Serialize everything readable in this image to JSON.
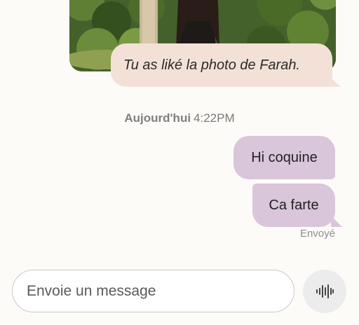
{
  "conversation": {
    "like_notice": "Tu as liké la photo de Farah.",
    "date_separator": {
      "day": "Aujourd'hui",
      "time": "4:22PM"
    },
    "messages": [
      {
        "text": "Hi coquine",
        "direction": "sent"
      },
      {
        "text": "Ca farte",
        "direction": "sent"
      }
    ],
    "delivery_status": "Envoyé"
  },
  "composer": {
    "placeholder": "Envoie un message",
    "voice_icon": "waveform-icon"
  },
  "colors": {
    "background": "#fdfbf8",
    "sent_bubble": "#d9c6da",
    "like_bubble": "#f3e1d8"
  }
}
